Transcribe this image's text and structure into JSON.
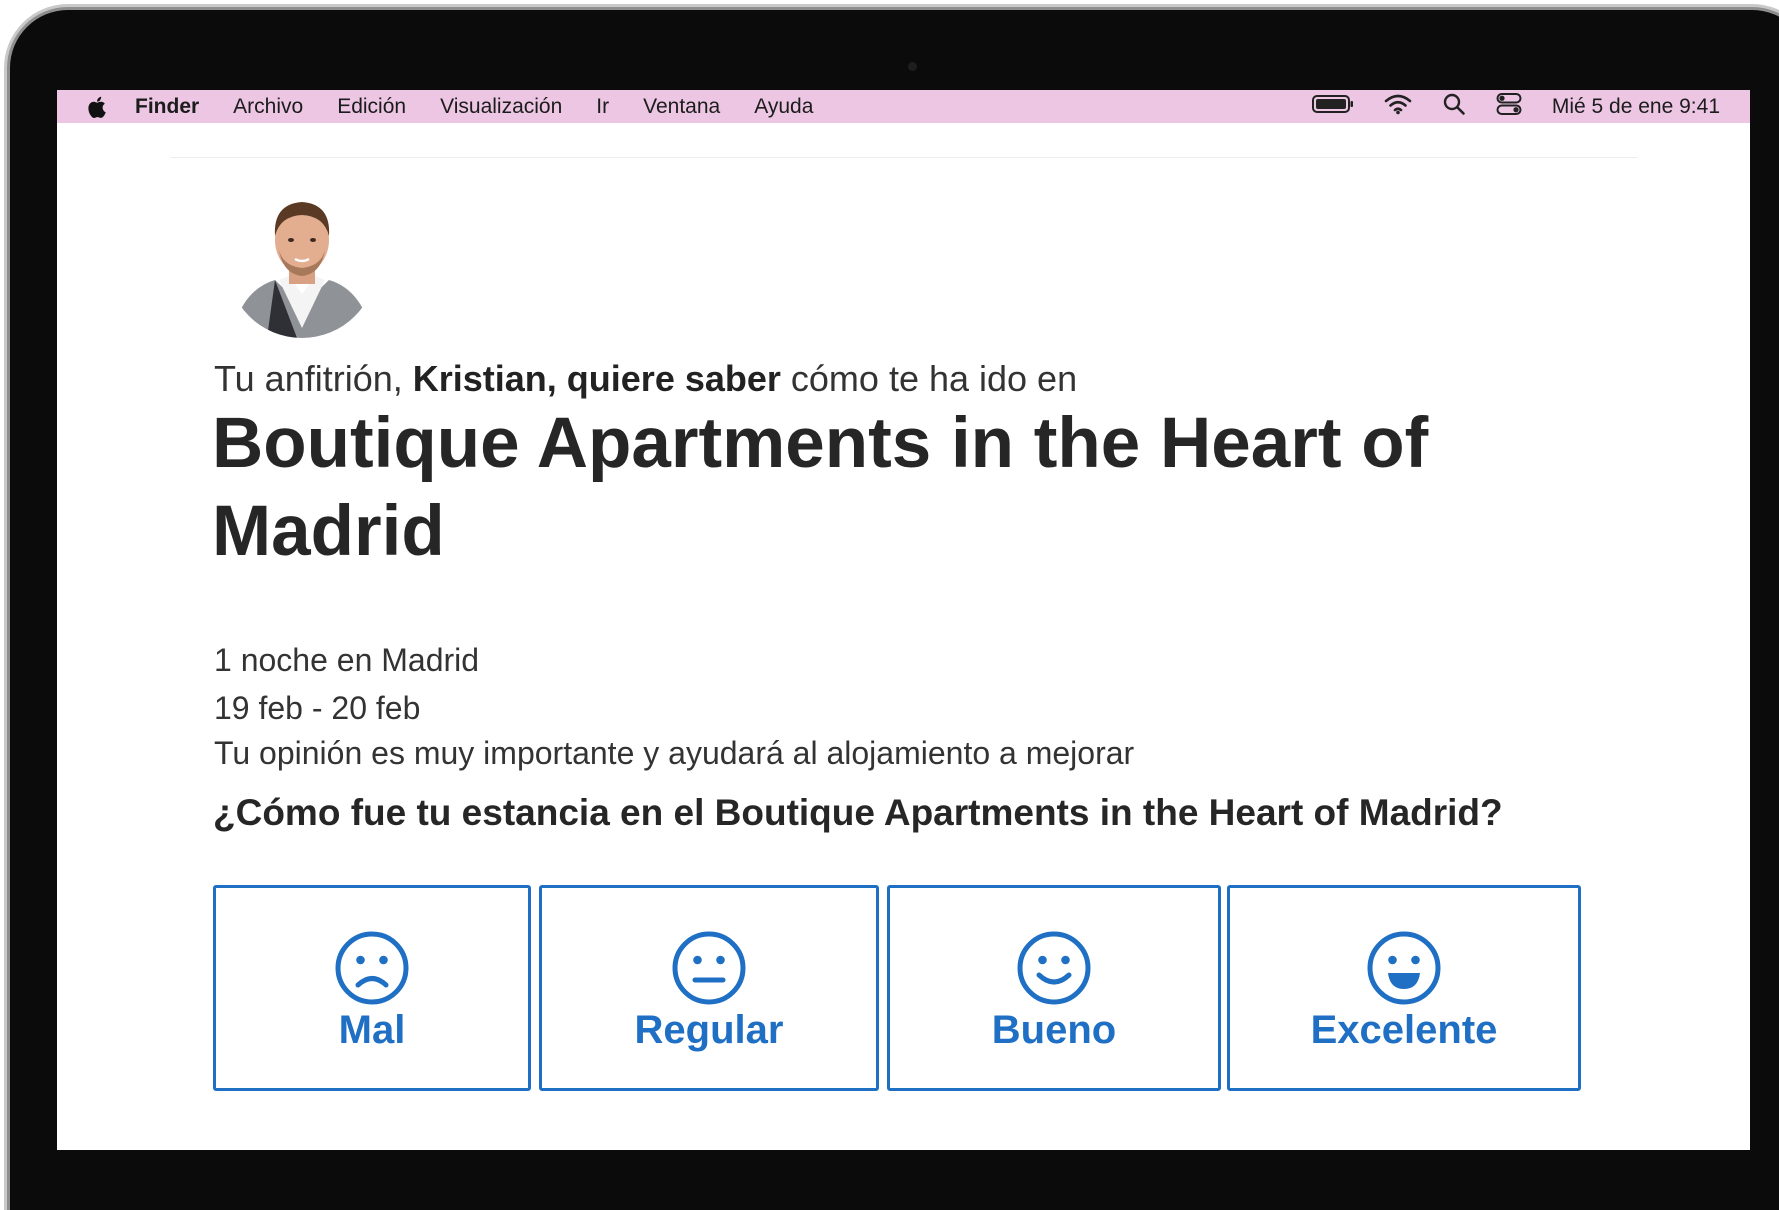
{
  "menubar": {
    "app_name": "Finder",
    "items": [
      "Archivo",
      "Edición",
      "Visualización",
      "Ir",
      "Ventana",
      "Ayuda"
    ],
    "status_icons": [
      "battery-icon",
      "wifi-icon",
      "spotlight-search-icon",
      "control-center-icon"
    ],
    "clock": "Mié 5 de ene  9:41"
  },
  "host": {
    "intro_prefix": "Tu anfitrión, ",
    "intro_bold": "Kristian, quiere saber",
    "intro_suffix": " cómo te ha ido en"
  },
  "property": {
    "name": "Boutique Apartments in the Heart of Madrid",
    "nights": "1 noche en Madrid",
    "dates": "19 feb - 20 feb",
    "note": "Tu opinión es muy importante y ayudará al alojamiento a mejorar"
  },
  "survey": {
    "question": "¿Cómo fue tu estancia en el Boutique Apartments in the Heart of Madrid?",
    "options": [
      {
        "label": "Mal",
        "icon": "sad-face-icon"
      },
      {
        "label": "Regular",
        "icon": "neutral-face-icon"
      },
      {
        "label": "Bueno",
        "icon": "smile-face-icon"
      },
      {
        "label": "Excelente",
        "icon": "grin-face-icon"
      }
    ]
  },
  "colors": {
    "menubar_bg": "#ecc6e3",
    "accent_blue": "#1f6fc4",
    "text_dark": "#262626"
  }
}
